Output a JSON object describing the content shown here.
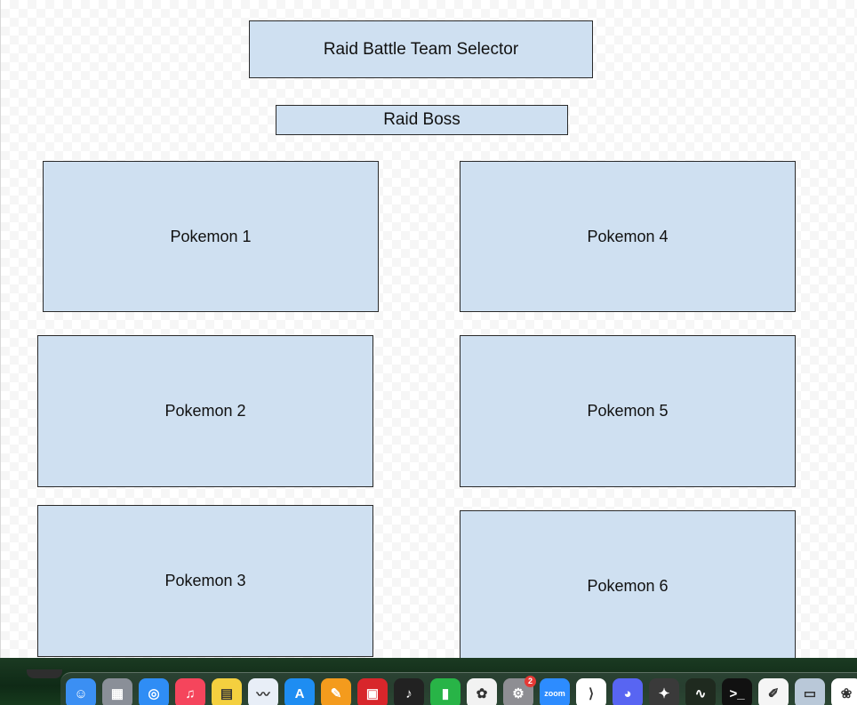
{
  "title": "Raid Battle Team Selector",
  "boss": "Raid Boss",
  "pokemon": [
    "Pokemon 1",
    "Pokemon 2",
    "Pokemon 3",
    "Pokemon 4",
    "Pokemon 5",
    "Pokemon 6"
  ],
  "dock": {
    "items": [
      {
        "name": "finder-icon",
        "color": "#3b8ff3",
        "glyph": "☺"
      },
      {
        "name": "launchpad-icon",
        "color": "#8a8f98",
        "glyph": "▦"
      },
      {
        "name": "safari-icon",
        "color": "#2f8df5",
        "glyph": "◎"
      },
      {
        "name": "music-icon",
        "color": "#f5455c",
        "glyph": "♫"
      },
      {
        "name": "notes-icon",
        "color": "#f4d03f",
        "glyph": "▤"
      },
      {
        "name": "freeform-icon",
        "color": "#e8eef7",
        "glyph": "〰"
      },
      {
        "name": "app-store-icon",
        "color": "#1e8df2",
        "glyph": "A"
      },
      {
        "name": "pages-icon",
        "color": "#f49b1d",
        "glyph": "✎"
      },
      {
        "name": "photo-booth-icon",
        "color": "#d8262b",
        "glyph": "▣"
      },
      {
        "name": "garageband-icon",
        "color": "#222222",
        "glyph": "♪"
      },
      {
        "name": "numbers-icon",
        "color": "#28b447",
        "glyph": "▮"
      },
      {
        "name": "chatgpt-icon",
        "color": "#f2f2f2",
        "glyph": "✿"
      },
      {
        "name": "system-settings-icon",
        "color": "#8e8e93",
        "glyph": "⚙",
        "badge": "2"
      },
      {
        "name": "zoom-icon",
        "color": "#2d8cff",
        "glyph": "zoom"
      },
      {
        "name": "vscode-icon",
        "color": "#ffffff",
        "glyph": "⟩"
      },
      {
        "name": "discord-icon",
        "color": "#5865f2",
        "glyph": "◕"
      },
      {
        "name": "compass-icon",
        "color": "#3a3a3a",
        "glyph": "✦"
      },
      {
        "name": "activity-monitor-icon",
        "color": "#1f2a1f",
        "glyph": "∿"
      },
      {
        "name": "terminal-icon",
        "color": "#111111",
        "glyph": ">_"
      },
      {
        "name": "textedit-icon",
        "color": "#f5f5f5",
        "glyph": "✐"
      },
      {
        "name": "preview-icon",
        "color": "#b9c8d8",
        "glyph": "▭"
      },
      {
        "name": "photos-icon",
        "color": "#ffffff",
        "glyph": "❀"
      }
    ]
  }
}
